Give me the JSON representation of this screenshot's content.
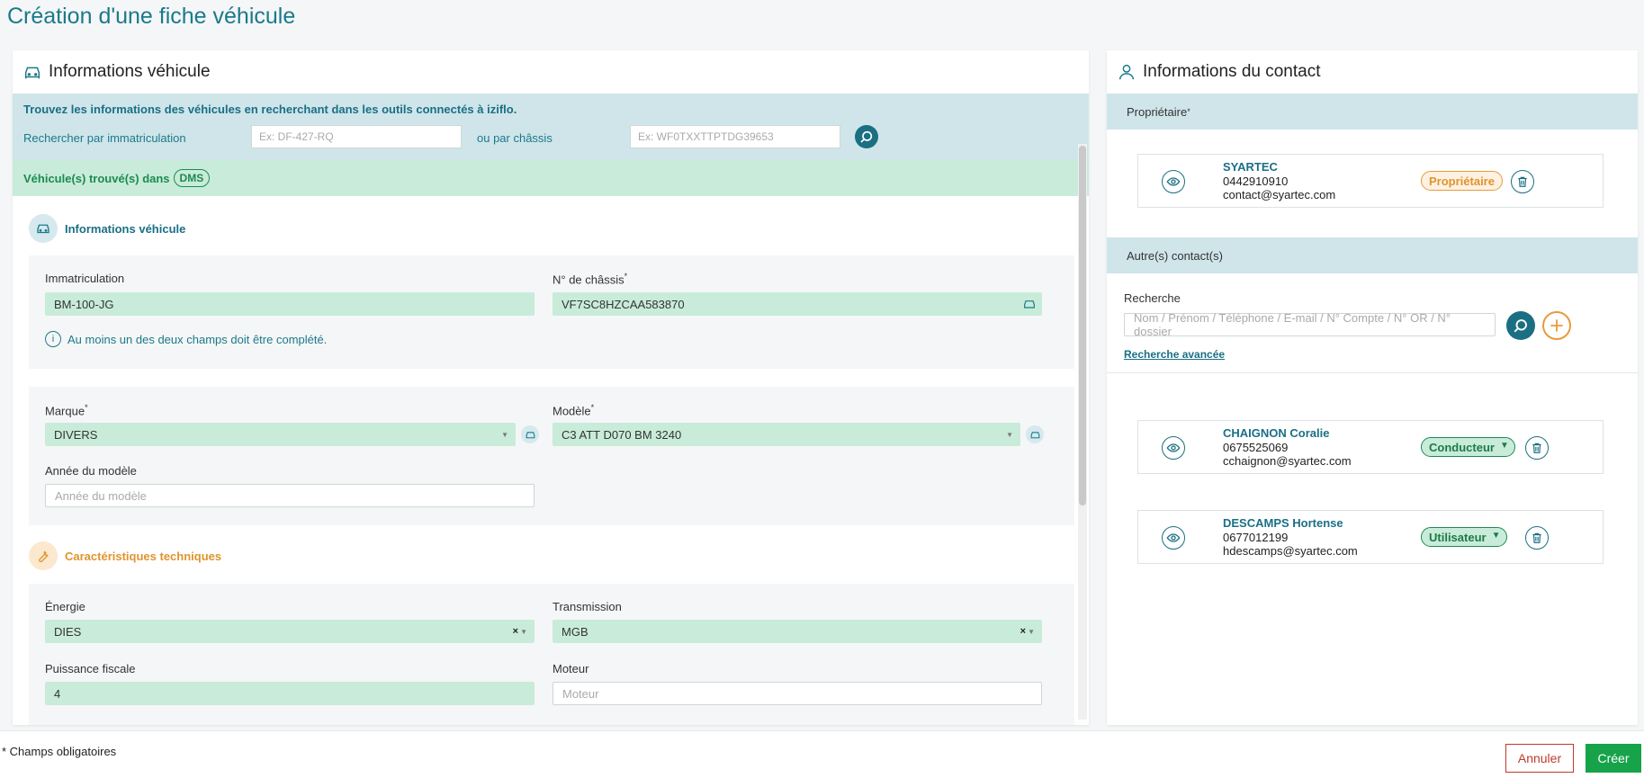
{
  "page_title": "Création d'une fiche véhicule",
  "vehicle_panel": {
    "title": "Informations véhicule",
    "search": {
      "intro": "Trouvez les informations des véhicules en recherchant dans les outils connectés à iziflo.",
      "plate_label": "Rechercher par immatriculation",
      "plate_placeholder": "Ex: DF-427-RQ",
      "chassis_label": "ou par châssis",
      "chassis_placeholder": "Ex: WF0TXXTTPTDG39653"
    },
    "found": {
      "text": "Véhicule(s) trouvé(s) dans",
      "badge": "DMS"
    },
    "vehicle_section": {
      "title": "Informations véhicule",
      "plate_label": "Immatriculation",
      "plate_value": "BM-100-JG",
      "chassis_label": "N° de châssis",
      "chassis_value": "VF7SC8HZCAA583870",
      "hint": "Au moins un des deux champs doit être complété.",
      "brand_label": "Marque",
      "brand_value": "DIVERS",
      "model_label": "Modèle",
      "model_value": "C3 ATT D070 BM 3240",
      "year_label": "Année du modèle",
      "year_placeholder": "Année du modèle"
    },
    "tech_section": {
      "title": "Caractéristiques techniques",
      "energy_label": "Énergie",
      "energy_value": "DIES",
      "transmission_label": "Transmission",
      "transmission_value": "MGB",
      "power_label": "Puissance fiscale",
      "power_value": "4",
      "engine_label": "Moteur",
      "engine_placeholder": "Moteur"
    }
  },
  "contact_panel": {
    "title": "Informations du contact",
    "owner_band": "Propriétaire",
    "owner": {
      "name": "SYARTEC",
      "phone": "0442910910",
      "email": "contact@syartec.com",
      "role": "Propriétaire"
    },
    "others_band": "Autre(s) contact(s)",
    "search_label": "Recherche",
    "search_placeholder": "Nom / Prénom / Téléphone / E-mail / N° Compte / N° OR / N° dossier",
    "advanced_link": "Recherche avancée",
    "contacts": [
      {
        "name": "CHAIGNON Coralie",
        "phone": "0675525069",
        "email": "cchaignon@syartec.com",
        "role": "Conducteur"
      },
      {
        "name": "DESCAMPS Hortense",
        "phone": "0677012199",
        "email": "hdescamps@syartec.com",
        "role": "Utilisateur"
      }
    ]
  },
  "footer": {
    "required_note": "* Champs obligatoires",
    "cancel_label": "Annuler",
    "create_label": "Créer"
  },
  "colors": {
    "primary": "#1a7a8a",
    "search_band": "#cfe5ea",
    "found_band": "#c8ecd9",
    "success": "#16a34a",
    "danger": "#c0392b",
    "orange": "#e89a3c"
  }
}
